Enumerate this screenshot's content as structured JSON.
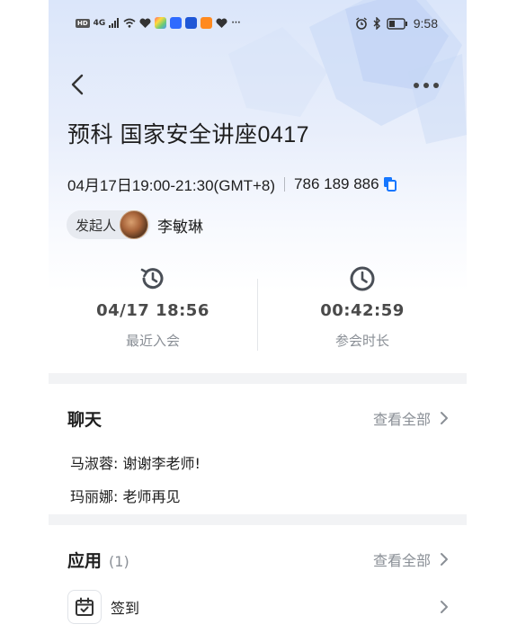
{
  "status_bar": {
    "left_indicators": [
      "HD",
      "4G"
    ],
    "time": "9:58"
  },
  "meeting": {
    "title": "预科 国家安全讲座0417",
    "datetime": "04月17日19:00-21:30(GMT+8)",
    "meeting_id": "786 189 886"
  },
  "host": {
    "tag_label": "发起人",
    "name": "李敏琳"
  },
  "stats": [
    {
      "value": "04/17 18:56",
      "label": "最近入会",
      "icon": "history-clock-icon"
    },
    {
      "value": "00:42:59",
      "label": "参会时长",
      "icon": "clock-icon"
    }
  ],
  "chat": {
    "title": "聊天",
    "view_all": "查看全部",
    "messages": [
      {
        "text": "马淑蓉: 谢谢李老师!"
      },
      {
        "text": "玛丽娜: 老师再见"
      }
    ]
  },
  "apps": {
    "title": "应用",
    "count": "(1)",
    "view_all": "查看全部",
    "items": [
      {
        "name": "签到",
        "icon": "check-in-calendar-icon"
      }
    ]
  },
  "colors": {
    "accent": "#1677ff",
    "text_primary": "#1e1e1e",
    "text_secondary": "#8a8f96",
    "header_gradient_top": "#dbe6fa"
  }
}
